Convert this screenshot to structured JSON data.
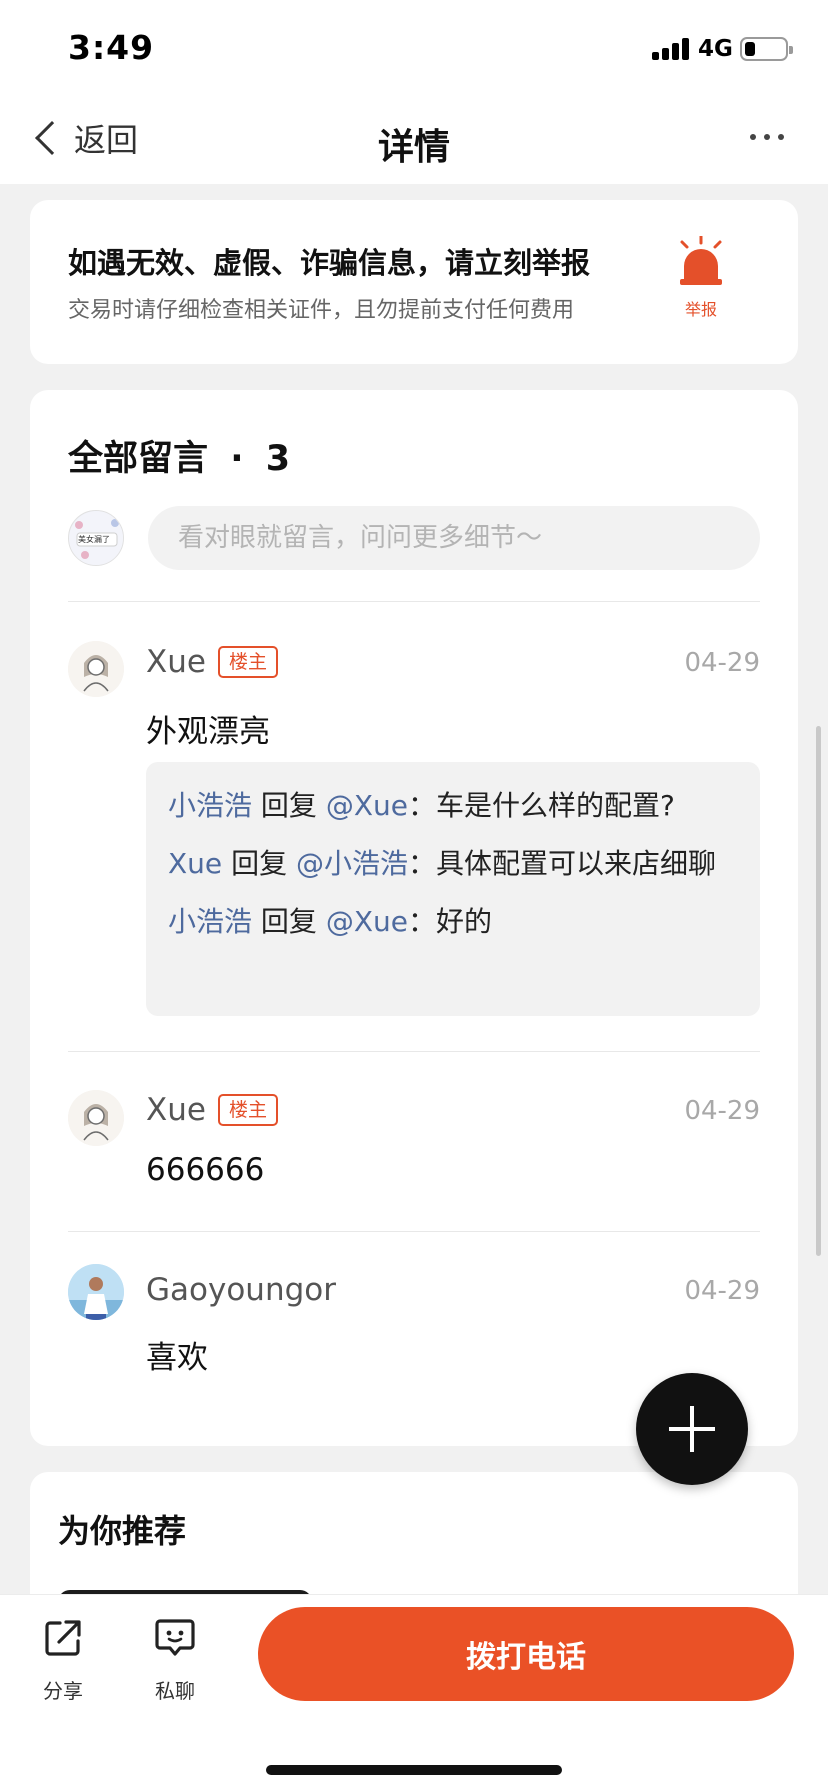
{
  "status_bar": {
    "time": "3:49",
    "network": "4G",
    "battery_level": 0.25
  },
  "nav": {
    "back_label": "返回",
    "title": "详情",
    "more_icon": "more-dots-icon"
  },
  "warning": {
    "title": "如遇无效、虚假、诈骗信息，请立刻举报",
    "subtitle": "交易时请仔细检查相关证件，且勿提前支付任何费用",
    "report_label": "举报",
    "accent": "#e4502a"
  },
  "comments": {
    "title": "全部留言",
    "separator": "·",
    "count": "3",
    "input_placeholder": "看对眼就留言，问问更多细节～",
    "my_avatar_text": "美女漏了",
    "items": [
      {
        "name": "Xue",
        "badge": "楼主",
        "date": "04-29",
        "text": "外观漂亮",
        "replies": [
          {
            "from": "小浩浩",
            "verb": "回复",
            "to": "@Xue",
            "colon": "：",
            "text": "车是什么样的配置?"
          },
          {
            "from": "Xue",
            "verb": "回复",
            "to": "@小浩浩",
            "colon": "：",
            "text": "具体配置可以来店细聊"
          },
          {
            "from": "小浩浩",
            "verb": "回复",
            "to": "@Xue",
            "colon": "：",
            "text": "好的"
          }
        ]
      },
      {
        "name": "Xue",
        "badge": "楼主",
        "date": "04-29",
        "text": "666666"
      },
      {
        "name": "Gaoyoungor",
        "date": "04-29",
        "text": "喜欢"
      }
    ]
  },
  "recommend": {
    "title": "为你推荐"
  },
  "bottom": {
    "share_label": "分享",
    "chat_label": "私聊",
    "call_label": "拨打电话",
    "call_color": "#ea5126"
  }
}
